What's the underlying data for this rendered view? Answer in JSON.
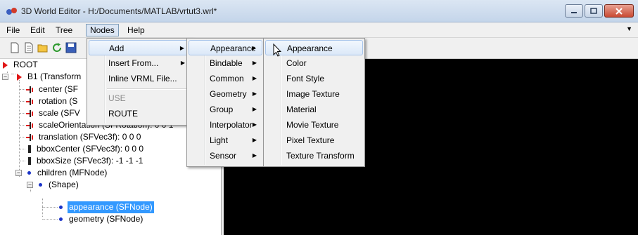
{
  "window": {
    "title": "3D World Editor - H:/Documents/MATLAB/vrtut3.wrl*",
    "controls": [
      "minimize-icon",
      "maximize-icon",
      "close-icon"
    ]
  },
  "menubar": {
    "items": [
      "File",
      "Edit",
      "Tree",
      "Nodes",
      "Help"
    ],
    "active": "Nodes"
  },
  "toolbar": {
    "icons": [
      "new-document-icon",
      "new-template-icon",
      "open-folder-icon",
      "reload-icon",
      "save-icon"
    ]
  },
  "tree": {
    "root": "ROOT",
    "b1": "B1 (Transform",
    "fields": {
      "center": "center (SF",
      "rotation": "rotation (S",
      "scale": "scale (SFV",
      "scaleOrientation": "scaleOrientation (SFRotation): 0 0 1",
      "translation": "translation (SFVec3f): 0 0 0",
      "bboxCenter": "bboxCenter (SFVec3f): 0 0 0",
      "bboxSize": "bboxSize (SFVec3f): -1 -1 -1"
    },
    "children": "children (MFNode)",
    "shape": "(Shape)",
    "appearance": "appearance (SFNode)",
    "geometry": "geometry (SFNode)"
  },
  "nodes_menu": {
    "items": [
      {
        "label": "Add",
        "submenu": true,
        "highlighted": true
      },
      {
        "label": "Insert From...",
        "submenu": true
      },
      {
        "label": "Inline VRML File...",
        "submenu": false
      },
      {
        "label": "USE",
        "disabled": true
      },
      {
        "label": "ROUTE",
        "disabled": false
      }
    ]
  },
  "add_menu": {
    "items": [
      {
        "label": "Appearance",
        "highlighted": true
      },
      {
        "label": "Bindable"
      },
      {
        "label": "Common"
      },
      {
        "label": "Geometry"
      },
      {
        "label": "Group"
      },
      {
        "label": "Interpolator"
      },
      {
        "label": "Light"
      },
      {
        "label": "Sensor"
      }
    ]
  },
  "appearance_menu": {
    "items": [
      {
        "label": "Appearance",
        "highlighted": true
      },
      {
        "label": "Color"
      },
      {
        "label": "Font Style"
      },
      {
        "label": "Image Texture"
      },
      {
        "label": "Material"
      },
      {
        "label": "Movie Texture"
      },
      {
        "label": "Pixel Texture"
      },
      {
        "label": "Texture Transform"
      }
    ]
  },
  "colors": {
    "selection": "#3399ff",
    "viewer_background": "#000000",
    "menu_highlight_border": "#a8c5ea",
    "root_triangle": "#e01616",
    "node_dot": "#1a33c8"
  }
}
